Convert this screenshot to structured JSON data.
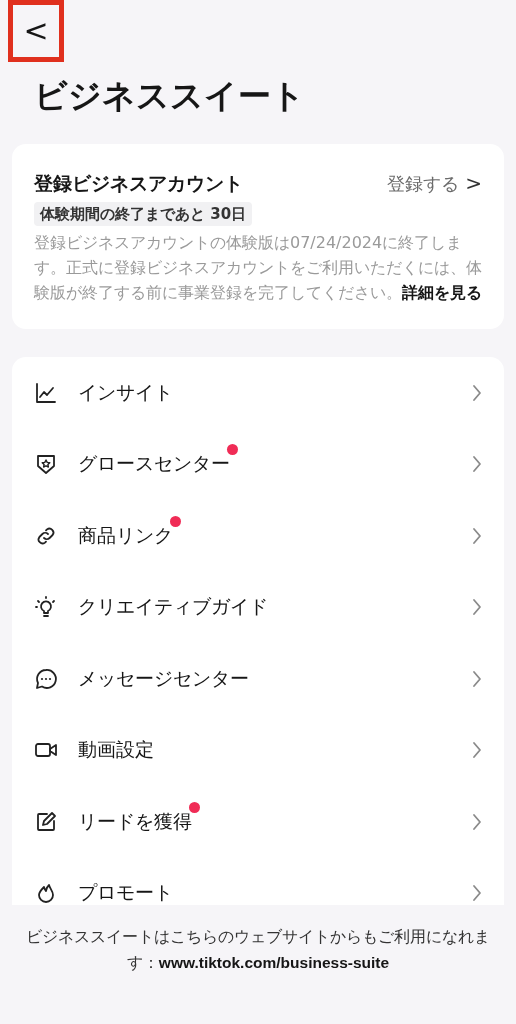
{
  "back_button": {
    "label": "<",
    "highlighted": true
  },
  "title": "ビジネススイート",
  "registration_card": {
    "title": "登録ビジネスアカウント",
    "action": "登録する",
    "action_chevron": ">",
    "trial_badge": "体験期間の終了まであと 30日",
    "description": "登録ビジネスアカウントの体験版は07/24/2024に終了します。正式に登録ビジネスアカウントをご利用いただくには、体験版が終了する前に事業登録を完了してください。",
    "details_link": "詳細を見る"
  },
  "menu_items": [
    {
      "label": "インサイト",
      "badge": false
    },
    {
      "label": "グロースセンター",
      "badge": true
    },
    {
      "label": "商品リンク",
      "badge": true
    },
    {
      "label": "クリエイティブガイド",
      "badge": false
    },
    {
      "label": "メッセージセンター",
      "badge": false
    },
    {
      "label": "動画設定",
      "badge": false
    },
    {
      "label": "リードを獲得",
      "badge": true
    },
    {
      "label": "プロモート",
      "badge": false
    }
  ],
  "footer": {
    "text": "ビジネススイートはこちらのウェブサイトからもご利用になれます：",
    "url": "www.tiktok.com/business-suite"
  }
}
